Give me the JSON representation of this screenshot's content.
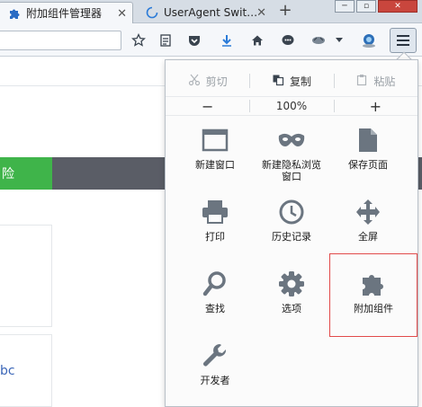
{
  "tabs": [
    {
      "label": "附加组件管理器",
      "active": true,
      "icon": "puzzle-icon"
    },
    {
      "label": "UserAgent Swit…",
      "active": false,
      "icon": "loading-icon"
    }
  ],
  "new_tab_label": "+",
  "window_controls": [
    "─",
    "▫",
    "✕"
  ],
  "navbar": {
    "url_value": "",
    "icons": [
      "bookmark-star-icon",
      "reading-list-icon",
      "pocket-icon",
      "download-icon",
      "home-icon",
      "chat-icon",
      "useragent-icon",
      "dropdown-icon",
      "profile-icon"
    ]
  },
  "page": {
    "green_button_label": "险",
    "link_text": "bc"
  },
  "menu": {
    "edit": {
      "cut_label": "剪切",
      "copy_label": "复制",
      "paste_label": "粘贴"
    },
    "zoom": {
      "minus": "−",
      "level": "100%",
      "plus": "+"
    },
    "items": [
      {
        "label": "新建窗口",
        "icon": "new-window-icon"
      },
      {
        "label": "新建隐私浏览\n窗口",
        "icon": "private-mask-icon"
      },
      {
        "label": "保存页面",
        "icon": "save-page-icon"
      },
      {
        "label": "打印",
        "icon": "print-icon"
      },
      {
        "label": "历史记录",
        "icon": "history-clock-icon"
      },
      {
        "label": "全屏",
        "icon": "fullscreen-icon"
      },
      {
        "label": "查找",
        "icon": "find-magnifier-icon"
      },
      {
        "label": "选项",
        "icon": "options-gear-icon"
      },
      {
        "label": "附加组件",
        "icon": "addons-puzzle-icon",
        "highlighted": true
      },
      {
        "label": "开发者",
        "icon": "developer-wrench-icon"
      }
    ]
  },
  "colors": {
    "accent_highlight": "#e14a4a",
    "green_button": "#3fb44a",
    "dark_bar": "#5a5d66",
    "icon_gray": "#6b7580"
  }
}
